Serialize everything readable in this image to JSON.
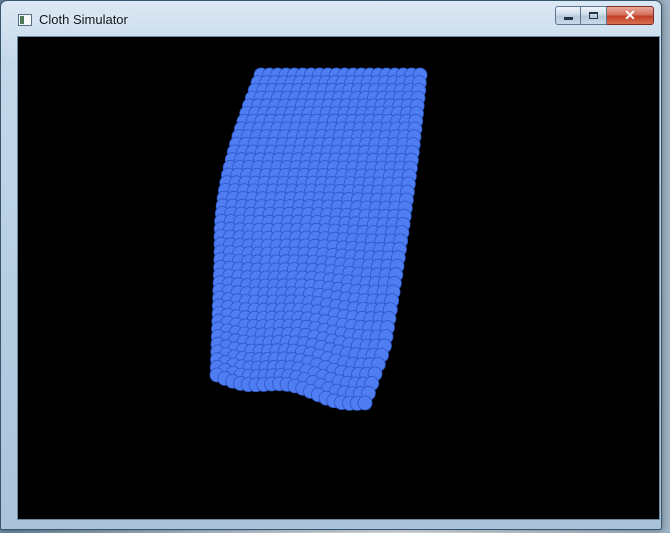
{
  "window": {
    "title": "Cloth Simulator",
    "icon": "app-window-icon",
    "controls": {
      "minimize": "minimize-icon",
      "maximize": "maximize-icon",
      "close": "close-icon",
      "close_glyph": "✕"
    }
  },
  "canvas": {
    "background": "#000000",
    "particle_color": "#4f7df2",
    "particle_outline": "#2f57c7"
  }
}
